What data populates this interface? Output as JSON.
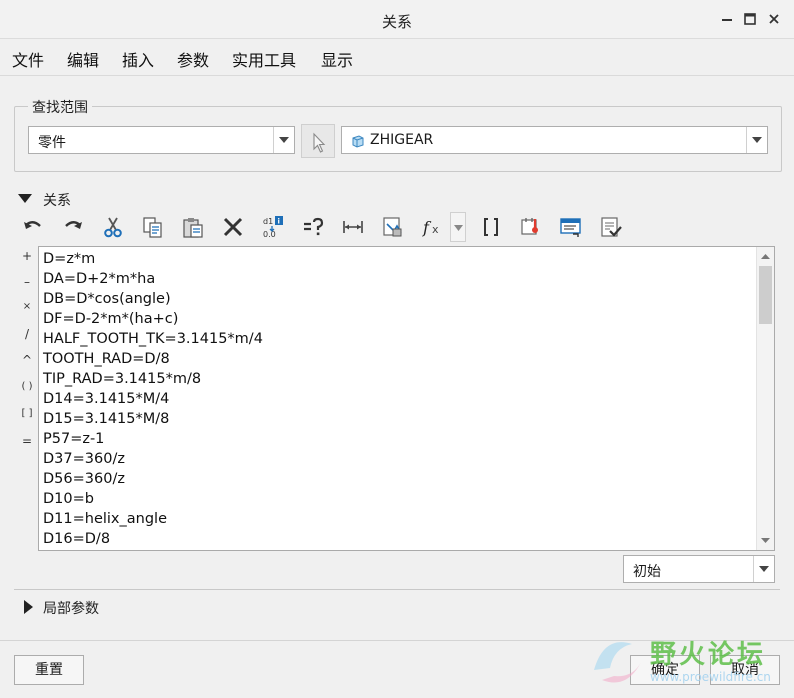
{
  "window": {
    "title": "关系",
    "controls": {
      "minimize": "minimize-icon",
      "maximize": "maximize-icon",
      "close": "close-icon"
    }
  },
  "menu": [
    "文件",
    "编辑",
    "插入",
    "参数",
    "实用工具",
    "显示"
  ],
  "lookup": {
    "legend": "查找范围",
    "type_value": "零件",
    "model_value": "ZHIGEAR"
  },
  "relations": {
    "label": "关系",
    "toolbar_icons": [
      "undo-icon",
      "redo-icon",
      "cut-icon",
      "copy-icon",
      "paste-icon",
      "delete-icon",
      "toggle-display-icon",
      "evaluate-icon",
      "measure-icon",
      "sort-icon",
      "function-icon",
      "brackets-icon",
      "verify-icon",
      "insert-feature-icon",
      "check-icon"
    ],
    "operators": [
      "+",
      "–",
      "×",
      "/",
      "^",
      "( )",
      "[ ]",
      "="
    ],
    "lines": [
      "D=z*m",
      "DA=D+2*m*ha",
      "DB=D*cos(angle)",
      "DF=D-2*m*(ha+c)",
      "HALF_TOOTH_TK=3.1415*m/4",
      "TOOTH_RAD=D/8",
      "TIP_RAD=3.1415*m/8",
      "D14=3.1415*M/4",
      "D15=3.1415*M/8",
      "P57=z-1",
      "D37=360/z",
      "D56=360/z",
      "D10=b",
      "D11=helix_angle",
      "D16=D/8"
    ],
    "mode_value": "初始"
  },
  "local_params": {
    "label": "局部参数"
  },
  "footer": {
    "reset": "重置",
    "ok": "确定",
    "cancel": "取消"
  },
  "watermark": {
    "title": "野火论坛",
    "url": "www.proewildfire.cn"
  },
  "colors": {
    "accent_blue": "#1e6fb8",
    "watermark_green": "#5fbf4a"
  }
}
